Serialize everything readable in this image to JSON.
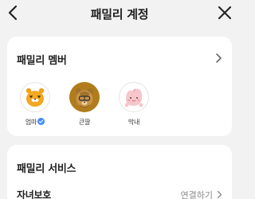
{
  "header": {
    "title": "패밀리 계정",
    "back_icon": "chevron-left-icon",
    "close_icon": "close-icon"
  },
  "members_card": {
    "title": "패밀리 멤버",
    "chevron_icon": "chevron-right-icon",
    "members": [
      {
        "name": "엄마",
        "avatar": "ryan-character-icon",
        "verified": true
      },
      {
        "name": "큰딸",
        "avatar": "frodo-character-icon",
        "verified": false
      },
      {
        "name": "막내",
        "avatar": "apeach-character-icon",
        "verified": false
      }
    ]
  },
  "services_card": {
    "title": "패밀리 서비스",
    "rows": [
      {
        "label": "자녀보호",
        "action": "연결하기"
      }
    ]
  },
  "colors": {
    "background": "#f2f2f2",
    "card": "#ffffff",
    "verify_badge": "#3d8bf2",
    "selected_avatar_bg": "#b07c1c"
  }
}
